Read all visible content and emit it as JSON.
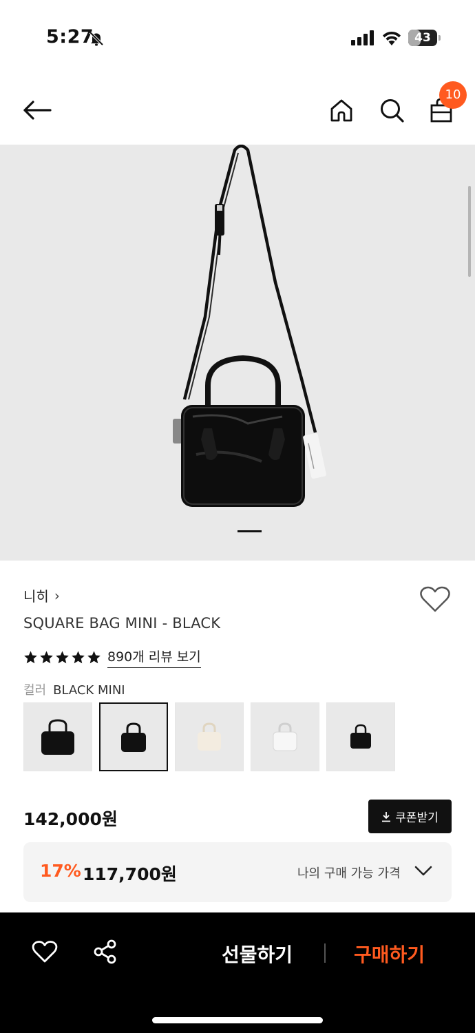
{
  "status_bar": {
    "time": "5:27",
    "battery_level": "43",
    "battery_fraction": 0.43
  },
  "nav": {
    "cart_count": "10"
  },
  "product": {
    "brand": "니히",
    "brand_chevron": "›",
    "title": "SQUARE BAG MINI - BLACK",
    "rating_stars": 5,
    "review_link": "890개 리뷰 보기",
    "color_label": "컬러",
    "color_value": "BLACK MINI",
    "swatches": [
      "black-large",
      "black-mini",
      "cream",
      "white",
      "black-small"
    ],
    "selected_swatch": 1,
    "price": "142,000원",
    "coupon_label": "쿠폰받기",
    "discount_rate": "17%",
    "discount_price": "117,700원",
    "my_price_label": "나의 구매 가능 가격"
  },
  "image_pager": {
    "current": 1
  },
  "bottom_bar": {
    "gift_label": "선물하기",
    "buy_label": "구매하기"
  },
  "colors": {
    "accent": "#ff5a1f",
    "dark": "#111111",
    "image_bg": "#e9e9e9"
  }
}
